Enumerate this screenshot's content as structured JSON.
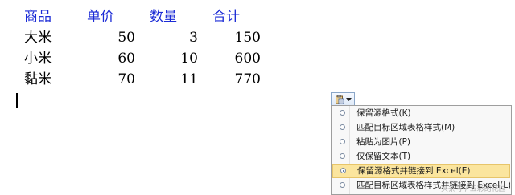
{
  "table": {
    "headers": [
      "商品",
      "单价",
      "数量",
      "合计"
    ],
    "rows": [
      [
        "大米",
        "50",
        "3",
        "150"
      ],
      [
        "小米",
        "60",
        "10",
        "600"
      ],
      [
        "黏米",
        "70",
        "11",
        "770"
      ]
    ]
  },
  "paste_options": {
    "icon": "clipboard-icon",
    "items": [
      {
        "label": "保留源格式(K)",
        "selected": false
      },
      {
        "label": "匹配目标区域表格样式(M)",
        "selected": false
      },
      {
        "label": "粘贴为图片(P)",
        "selected": false
      },
      {
        "label": "仅保留文本(T)",
        "selected": false
      },
      {
        "label": "保留源格式并链接到 Excel(E)",
        "selected": true
      },
      {
        "label": "匹配目标区域表格样式并链接到 Excel(L)",
        "selected": false
      }
    ]
  },
  "watermark": "头条号 / 五彩的花园",
  "colors": {
    "header_link": "#1b2bd6",
    "selected_bg": "#fbe59e"
  }
}
